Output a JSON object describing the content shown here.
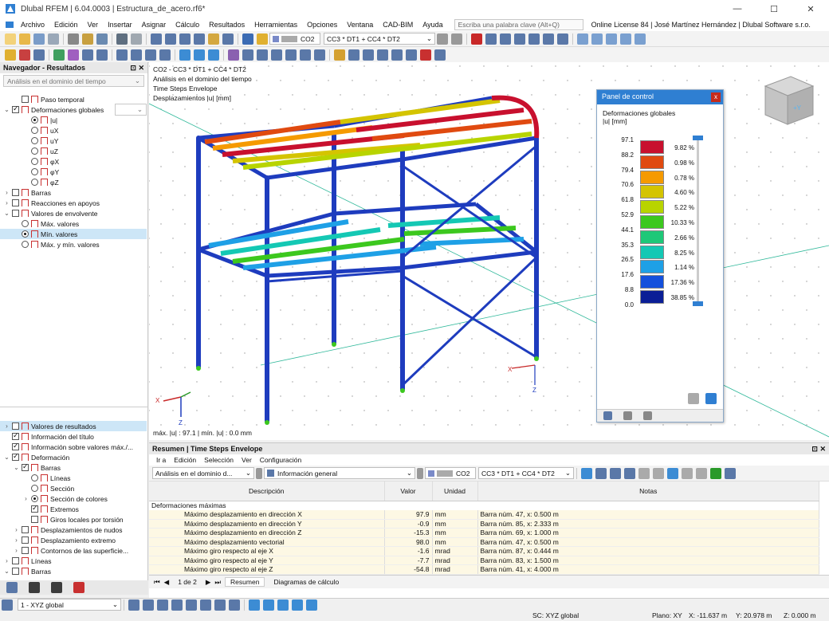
{
  "window": {
    "title": "Dlubal RFEM | 6.04.0003 | Estructura_de_acero.rf6*",
    "controls": [
      "—",
      "☐",
      "✕"
    ]
  },
  "menu": {
    "items": [
      "Archivo",
      "Edición",
      "Ver",
      "Insertar",
      "Asignar",
      "Cálculo",
      "Resultados",
      "Herramientas",
      "Opciones",
      "Ventana",
      "CAD-BIM",
      "Ayuda"
    ],
    "search_placeholder": "Escriba una palabra clave (Alt+Q)",
    "license": "Online License 84 | José Martínez Hernández | Dlubal Software s.r.o."
  },
  "toolbar": {
    "load_case": "CO2",
    "combination": "CC3 * DT1 + CC4 * DT2"
  },
  "navigator": {
    "title": "Navegador - Resultados",
    "analysis": "Análisis en el dominio del tiempo",
    "top_items": [
      {
        "label": "Paso temporal",
        "kind": "cb",
        "on": false,
        "indent": 1
      },
      {
        "label": "Deformaciones globales",
        "kind": "cb",
        "on": true,
        "indent": 0,
        "exp": "⌄"
      },
      {
        "label": "|u|",
        "kind": "rb",
        "on": true,
        "indent": 2
      },
      {
        "label": "uX",
        "kind": "rb",
        "on": false,
        "indent": 2
      },
      {
        "label": "uY",
        "kind": "rb",
        "on": false,
        "indent": 2
      },
      {
        "label": "uZ",
        "kind": "rb",
        "on": false,
        "indent": 2
      },
      {
        "label": "φX",
        "kind": "rb",
        "on": false,
        "indent": 2
      },
      {
        "label": "φY",
        "kind": "rb",
        "on": false,
        "indent": 2
      },
      {
        "label": "φZ",
        "kind": "rb",
        "on": false,
        "indent": 2
      },
      {
        "label": "Barras",
        "kind": "cb",
        "on": false,
        "indent": 0,
        "exp": "›"
      },
      {
        "label": "Reacciones en apoyos",
        "kind": "cb",
        "on": false,
        "indent": 0,
        "exp": "›"
      },
      {
        "label": "Valores de envolvente",
        "kind": "cb",
        "on": false,
        "indent": 0,
        "exp": "⌄"
      },
      {
        "label": "Máx. valores",
        "kind": "rb",
        "on": false,
        "indent": 1
      },
      {
        "label": "Mín. valores",
        "kind": "rb",
        "on": true,
        "indent": 1,
        "sel": true
      },
      {
        "label": "Máx. y mín. valores",
        "kind": "rb",
        "on": false,
        "indent": 1
      }
    ],
    "bottom_items": [
      {
        "label": "Valores de resultados",
        "kind": "cb",
        "on": false,
        "indent": 0,
        "exp": "›",
        "sel": true
      },
      {
        "label": "Información del título",
        "kind": "cb",
        "on": true,
        "indent": 0
      },
      {
        "label": "Información sobre valores máx./...",
        "kind": "cb",
        "on": true,
        "indent": 0
      },
      {
        "label": "Deformación",
        "kind": "cb",
        "on": true,
        "indent": 0,
        "exp": "⌄"
      },
      {
        "label": "Barras",
        "kind": "cb",
        "on": true,
        "indent": 1,
        "exp": "⌄"
      },
      {
        "label": "Líneas",
        "kind": "rb",
        "on": false,
        "indent": 2
      },
      {
        "label": "Sección",
        "kind": "rb",
        "on": false,
        "indent": 2
      },
      {
        "label": "Sección de colores",
        "kind": "rb",
        "on": true,
        "indent": 2,
        "exp": "›"
      },
      {
        "label": "Extremos",
        "kind": "cb",
        "on": true,
        "indent": 2
      },
      {
        "label": "Giros locales por torsión",
        "kind": "cb",
        "on": false,
        "indent": 2
      },
      {
        "label": "Desplazamientos de nudos",
        "kind": "cb",
        "on": false,
        "indent": 1,
        "exp": "›"
      },
      {
        "label": "Desplazamiento extremo",
        "kind": "cb",
        "on": false,
        "indent": 1,
        "exp": "›"
      },
      {
        "label": "Contornos de las superficie...",
        "kind": "cb",
        "on": false,
        "indent": 1,
        "exp": "›"
      },
      {
        "label": "Líneas",
        "kind": "cb",
        "on": false,
        "indent": 0,
        "exp": "›"
      },
      {
        "label": "Barras",
        "kind": "cb",
        "on": false,
        "indent": 0,
        "exp": "⌄"
      }
    ]
  },
  "viewport": {
    "info_lines": [
      "CO2 - CC3 * DT1 + CC4 * DT2",
      "Análisis en el dominio del tiempo",
      "Time Steps Envelope",
      "Desplazamientos |u| [mm]"
    ],
    "footer": "máx. |u| : 97.1 | mín. |u| : 0.0 mm",
    "axis_labels": [
      "X",
      "Z"
    ]
  },
  "control_panel": {
    "title": "Panel de control",
    "close": "x",
    "subtitle": "Deformaciones globales",
    "unit": "|u| [mm]",
    "legend_values": [
      "97.1",
      "88.2",
      "79.4",
      "70.6",
      "61.8",
      "52.9",
      "44.1",
      "35.3",
      "26.5",
      "17.6",
      "8.8",
      "0.0"
    ],
    "legend_colors": [
      "#c8102e",
      "#e04a10",
      "#f59a00",
      "#d4c400",
      "#b8d400",
      "#3cc81e",
      "#1ec878",
      "#14c8b4",
      "#1ea0e6",
      "#1450dc",
      "#0a1e96"
    ],
    "legend_percents": [
      "9.82 %",
      "0.98 %",
      "0.78 %",
      "4.60 %",
      "5.22 %",
      "10.33 %",
      "2.66 %",
      "8.25 %",
      "1.14 %",
      "17.36 %",
      "38.85 %"
    ]
  },
  "results": {
    "title": "Resumen | Time Steps Envelope",
    "menu": [
      "Ir a",
      "Edición",
      "Selección",
      "Ver",
      "Configuración"
    ],
    "analysis": "Análisis en el dominio d...",
    "info_type": "Información general",
    "load_case": "CO2",
    "combination": "CC3 * DT1 + CC4 * DT2",
    "columns": [
      "Descripción",
      "Valor",
      "Unidad",
      "Notas"
    ],
    "group": "Deformaciones máximas",
    "rows": [
      {
        "desc": "Máximo desplazamiento en dirección X",
        "val": "97.9",
        "unit": "mm",
        "note": "Barra núm. 47, x: 0.500 m"
      },
      {
        "desc": "Máximo desplazamiento en dirección Y",
        "val": "-0.9",
        "unit": "mm",
        "note": "Barra núm. 85, x: 2.333 m"
      },
      {
        "desc": "Máximo desplazamiento en dirección Z",
        "val": "-15.3",
        "unit": "mm",
        "note": "Barra núm. 69, x: 1.000 m"
      },
      {
        "desc": "Máximo desplazamiento vectorial",
        "val": "98.0",
        "unit": "mm",
        "note": "Barra núm. 47, x: 0.500 m"
      },
      {
        "desc": "Máximo giro respecto al eje X",
        "val": "-1.6",
        "unit": "mrad",
        "note": "Barra núm. 87, x: 0.444 m"
      },
      {
        "desc": "Máximo giro respecto al eje Y",
        "val": "-7.7",
        "unit": "mrad",
        "note": "Barra núm. 83, x: 1.500 m"
      },
      {
        "desc": "Máximo giro respecto al eje Z",
        "val": "-54.8",
        "unit": "mrad",
        "note": "Barra núm. 41, x: 4.000 m"
      }
    ],
    "page": "1 de 2",
    "tabs": [
      "Resumen",
      "Diagramas de cálculo"
    ]
  },
  "status": {
    "view": "1 - XYZ global",
    "sc": "SC: XYZ global",
    "plane": "Plano: XY",
    "x": "X: -11.637 m",
    "y": "Y: 20.978 m",
    "z": "Z: 0.000 m"
  }
}
